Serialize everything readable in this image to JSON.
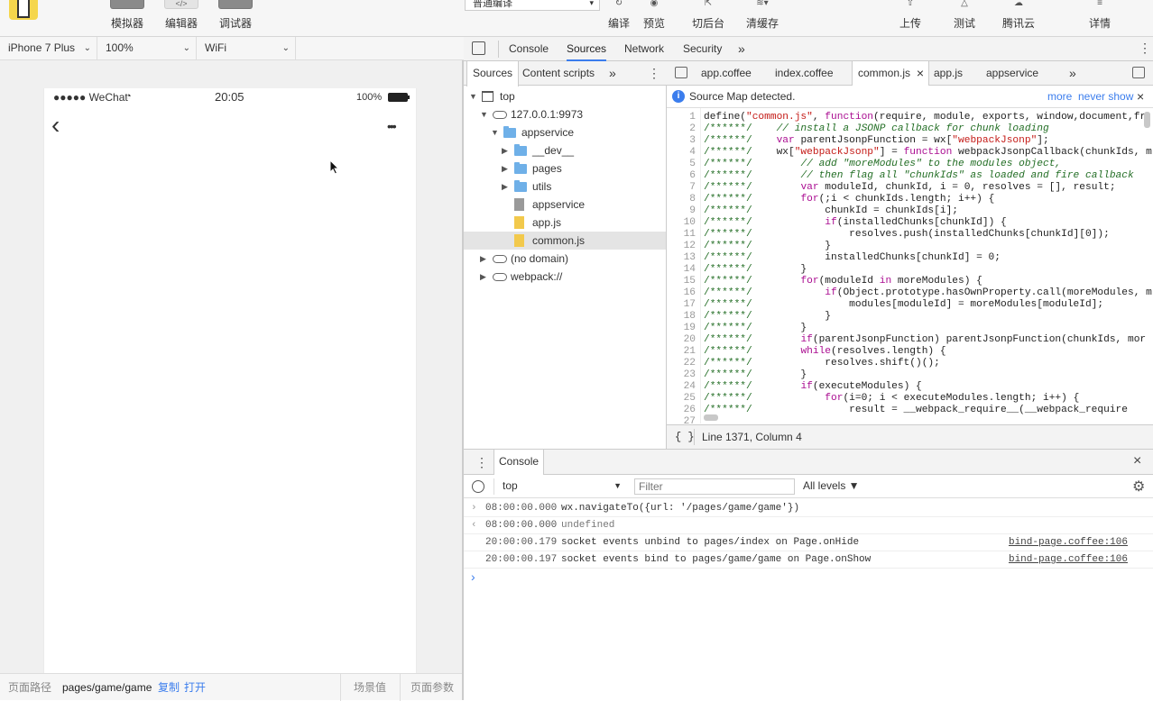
{
  "toolbar": {
    "simulator": "模拟器",
    "editor": "编辑器",
    "debugger": "调试器",
    "compile_mode": "普通编译",
    "compile": "编译",
    "preview": "预览",
    "background": "切后台",
    "clear_cache": "清缓存",
    "upload": "上传",
    "test": "测试",
    "tencent_cloud": "腾讯云",
    "details": "详情"
  },
  "device_bar": {
    "device": "iPhone 7 Plus",
    "zoom": "100%",
    "network": "WiFi"
  },
  "phone": {
    "carrier": "●●●●● WeChat",
    "time": "20:05",
    "battery": "100%",
    "back_glyph": "‹",
    "more_glyph": "•••"
  },
  "bottom_bar": {
    "path_label": "页面路径",
    "path": "pages/game/game",
    "copy": "复制",
    "open": "打开",
    "scene": "场景值",
    "params": "页面参数"
  },
  "devtools": {
    "tabs": [
      "Console",
      "Sources",
      "Network",
      "Security"
    ],
    "active_tab": "Sources",
    "more": "»"
  },
  "navigator": {
    "tabs": [
      "Sources",
      "Content scripts"
    ],
    "more": "»",
    "tree": [
      {
        "label": "top",
        "type": "page",
        "depth": 0,
        "toggle": "▼"
      },
      {
        "label": "127.0.0.1:9973",
        "type": "cloud",
        "depth": 1,
        "toggle": "▼"
      },
      {
        "label": "appservice",
        "type": "folder",
        "depth": 2,
        "toggle": "▼"
      },
      {
        "label": "__dev__",
        "type": "folder",
        "depth": 3,
        "toggle": "▶"
      },
      {
        "label": "pages",
        "type": "folder",
        "depth": 3,
        "toggle": "▶"
      },
      {
        "label": "utils",
        "type": "folder",
        "depth": 3,
        "toggle": "▶"
      },
      {
        "label": "appservice",
        "type": "file",
        "depth": 3,
        "toggle": ""
      },
      {
        "label": "app.js",
        "type": "js",
        "depth": 3,
        "toggle": ""
      },
      {
        "label": "common.js",
        "type": "js",
        "depth": 3,
        "toggle": "",
        "selected": true
      },
      {
        "label": "(no domain)",
        "type": "cloud",
        "depth": 1,
        "toggle": "▶"
      },
      {
        "label": "webpack://",
        "type": "cloud",
        "depth": 1,
        "toggle": "▶"
      }
    ]
  },
  "editor": {
    "tabs": [
      "app.coffee",
      "index.coffee",
      "common.js",
      "app.js",
      "appservice"
    ],
    "active_tab": "common.js",
    "close_glyph": "×",
    "source_map": "Source Map detected.",
    "more_link": "more",
    "never_show": "never show",
    "status_brace": "{ }",
    "cursor_position": "Line 1371, Column 4",
    "lines": [
      {
        "n": "1",
        "t": "define(\"common.js\", function(require, module, exports, window,document,fr"
      },
      {
        "n": "2",
        "t": "/******/    // install a JSONP callback for chunk loading"
      },
      {
        "n": "3",
        "t": "/******/    var parentJsonpFunction = wx[\"webpackJsonp\"];"
      },
      {
        "n": "4",
        "t": "/******/    wx[\"webpackJsonp\"] = function webpackJsonpCallback(chunkIds, m"
      },
      {
        "n": "5",
        "t": "/******/        // add \"moreModules\" to the modules object,"
      },
      {
        "n": "6",
        "t": "/******/        // then flag all \"chunkIds\" as loaded and fire callback"
      },
      {
        "n": "7",
        "t": "/******/        var moduleId, chunkId, i = 0, resolves = [], result;"
      },
      {
        "n": "8",
        "t": "/******/        for(;i < chunkIds.length; i++) {"
      },
      {
        "n": "9",
        "t": "/******/            chunkId = chunkIds[i];"
      },
      {
        "n": "10",
        "t": "/******/            if(installedChunks[chunkId]) {"
      },
      {
        "n": "11",
        "t": "/******/                resolves.push(installedChunks[chunkId][0]);"
      },
      {
        "n": "12",
        "t": "/******/            }"
      },
      {
        "n": "13",
        "t": "/******/            installedChunks[chunkId] = 0;"
      },
      {
        "n": "14",
        "t": "/******/        }"
      },
      {
        "n": "15",
        "t": "/******/        for(moduleId in moreModules) {"
      },
      {
        "n": "16",
        "t": "/******/            if(Object.prototype.hasOwnProperty.call(moreModules, m"
      },
      {
        "n": "17",
        "t": "/******/                modules[moduleId] = moreModules[moduleId];"
      },
      {
        "n": "18",
        "t": "/******/            }"
      },
      {
        "n": "19",
        "t": "/******/        }"
      },
      {
        "n": "20",
        "t": "/******/        if(parentJsonpFunction) parentJsonpFunction(chunkIds, mor"
      },
      {
        "n": "21",
        "t": "/******/        while(resolves.length) {"
      },
      {
        "n": "22",
        "t": "/******/            resolves.shift()();"
      },
      {
        "n": "23",
        "t": "/******/        }"
      },
      {
        "n": "24",
        "t": "/******/        if(executeModules) {"
      },
      {
        "n": "25",
        "t": "/******/            for(i=0; i < executeModules.length; i++) {"
      },
      {
        "n": "26",
        "t": "/******/                result = __webpack_require__(__webpack_require"
      },
      {
        "n": "27",
        "t": ""
      }
    ]
  },
  "console": {
    "tab": "Console",
    "context": "top",
    "filter_placeholder": "Filter",
    "levels": "All levels ▼",
    "messages": [
      {
        "kind": "input",
        "time": "08:00:00.000",
        "text": "wx.navigateTo({url: '/pages/game/game'})",
        "source": ""
      },
      {
        "kind": "result",
        "time": "08:00:00.000",
        "text": "undefined",
        "source": ""
      },
      {
        "kind": "log",
        "time": "20:00:00.179",
        "text": "socket events unbind to pages/index on Page.onHide",
        "source": "bind-page.coffee:106"
      },
      {
        "kind": "log",
        "time": "20:00:00.197",
        "text": "socket events bind to pages/game/game on Page.onShow",
        "source": "bind-page.coffee:106"
      }
    ],
    "prompt": "›"
  },
  "colors": {
    "accent": "#3b7ded",
    "folder": "#6fb0e8",
    "js_file": "#f2c94c",
    "comment": "#236e25",
    "keyword": "#aa0d91",
    "string": "#c41a16"
  }
}
